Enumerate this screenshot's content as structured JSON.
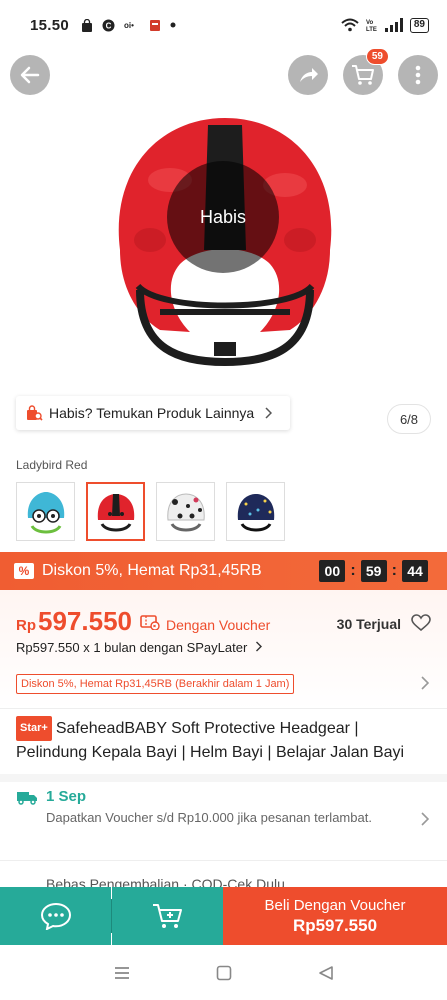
{
  "status_bar": {
    "time": "15.50",
    "battery": "89"
  },
  "header": {
    "cart_count": "59"
  },
  "image_overlay": {
    "sold_out_text": "Habis",
    "find_more": "Habis? Temukan Produk Lainnya",
    "page_indicator": "6/8"
  },
  "variants": {
    "selected_label": "Ladybird Red",
    "items": [
      {
        "name": "blue-frog",
        "color": "#3fb7d6"
      },
      {
        "name": "ladybird-red",
        "color": "#e0232c"
      },
      {
        "name": "white-dalmatian",
        "color": "#e8e8e8"
      },
      {
        "name": "navy-space",
        "color": "#1f2a5a"
      }
    ]
  },
  "flash_bar": {
    "pct_icon": "%",
    "text": "Diskon 5%, Hemat Rp31,45RB",
    "timer": [
      "00",
      "59",
      "44"
    ]
  },
  "price": {
    "currency": "Rp",
    "value": "597.550",
    "voucher_text": "Dengan Voucher",
    "sold": "30 Terjual",
    "paylater": "Rp597.550 x 1 bulan dengan SPayLater",
    "discount_tag": "Diskon 5%, Hemat Rp31,45RB (Berakhir dalam 1 Jam)"
  },
  "product": {
    "badge": "Star+",
    "title": "SafeheadBABY Soft Protective Headgear | Pelindung Kepala Bayi | Helm Bayi | Belajar Jalan Bayi"
  },
  "shipping": {
    "headline": "1 Sep",
    "desc": "Dapatkan Voucher s/d Rp10.000 jika pesanan terlambat.",
    "partial_next": "Bebas Pengembalian · COD-Cek Dulu"
  },
  "actions": {
    "buy_line1": "Beli Dengan Voucher",
    "buy_line2": "Rp597.550"
  },
  "colors": {
    "brand": "#ee4d2d",
    "teal": "#26aa99"
  }
}
